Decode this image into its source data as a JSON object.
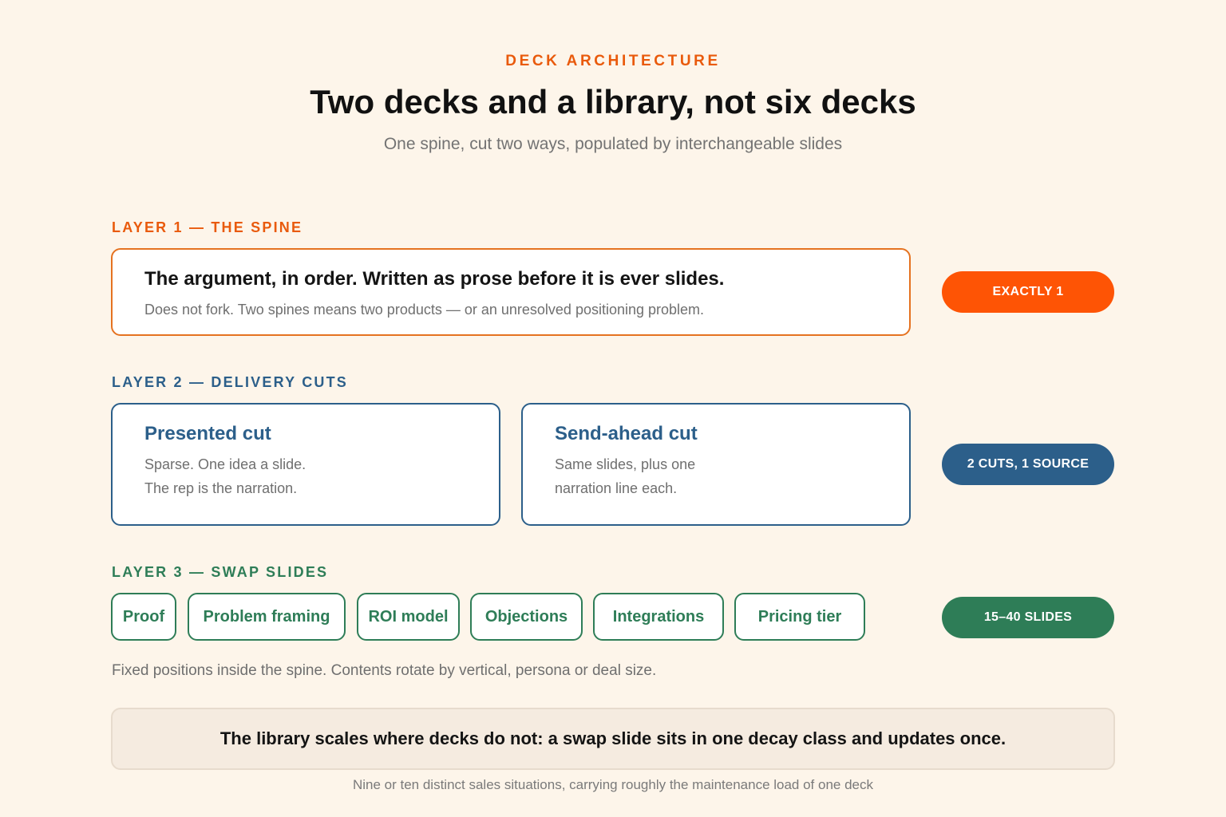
{
  "header": {
    "eyebrow": "DECK ARCHITECTURE",
    "title": "Two decks and a library, not six decks",
    "subtitle": "One spine, cut two ways, populated by interchangeable slides"
  },
  "colors": {
    "background": "#fdf5ea",
    "spine_accent": "#e95a0c",
    "cuts_accent": "#2c5f8a",
    "swap_accent": "#2e7d57",
    "callout_background": "#f5ebe0"
  },
  "layer1": {
    "label": "LAYER 1 — THE SPINE",
    "card_title": "The argument, in order. Written as prose before it is ever slides.",
    "card_desc": "Does not fork. Two spines means two products — or an unresolved positioning problem.",
    "badge": "EXACTLY 1"
  },
  "layer2": {
    "label": "LAYER 2 — DELIVERY CUTS",
    "cuts": [
      {
        "title": "Presented cut",
        "lines": [
          "Sparse. One idea a slide.",
          "The rep is the narration."
        ]
      },
      {
        "title": "Send-ahead cut",
        "lines": [
          "Same slides, plus one",
          "narration line each."
        ]
      }
    ],
    "badge": "2 CUTS, 1 SOURCE"
  },
  "layer3": {
    "label": "LAYER 3 — SWAP SLIDES",
    "slides": [
      "Proof",
      "Problem framing",
      "ROI model",
      "Objections",
      "Integrations",
      "Pricing tier"
    ],
    "badge": "15–40 SLIDES",
    "note": "Fixed positions inside the spine. Contents rotate by vertical, persona or deal size."
  },
  "callout": {
    "text": "The library scales where decks do not: a swap slide sits in one decay class and updates once."
  },
  "footnote": "Nine or ten distinct sales situations, carrying roughly the maintenance load of one deck"
}
